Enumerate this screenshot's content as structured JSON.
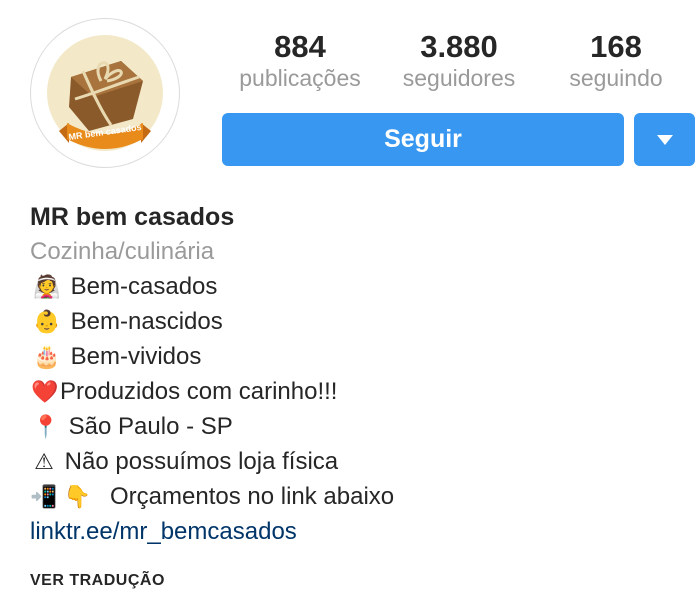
{
  "profile": {
    "avatar_text": "MR bem casados",
    "stats": [
      {
        "count": "884",
        "label": "publicações"
      },
      {
        "count": "3.880",
        "label": "seguidores"
      },
      {
        "count": "168",
        "label": "seguindo"
      }
    ],
    "follow_label": "Seguir",
    "dropdown_icon": "triangle-down-icon"
  },
  "bio": {
    "name": "MR bem casados",
    "category": "Cozinha/culinária",
    "lines": [
      {
        "emoji": "👰",
        "text": "Bem-casados"
      },
      {
        "emoji": "👶",
        "text": "Bem-nascidos"
      },
      {
        "emoji": "🎂",
        "text": "Bem-vividos"
      },
      {
        "emoji": "❤️",
        "text": "Produzidos com carinho!!!"
      },
      {
        "emoji": "📍",
        "text": "São Paulo - SP"
      },
      {
        "emoji": "⚠",
        "text": "Não possuímos loja física"
      },
      {
        "emoji": "📲 👇",
        "text": "Orçamentos no link abaixo"
      }
    ],
    "link": "linktr.ee/mr_bemcasados"
  },
  "translate_label": "VER TRADUÇÃO",
  "colors": {
    "accent": "#3897f0",
    "link": "#003569",
    "muted": "#9a9a9a"
  }
}
